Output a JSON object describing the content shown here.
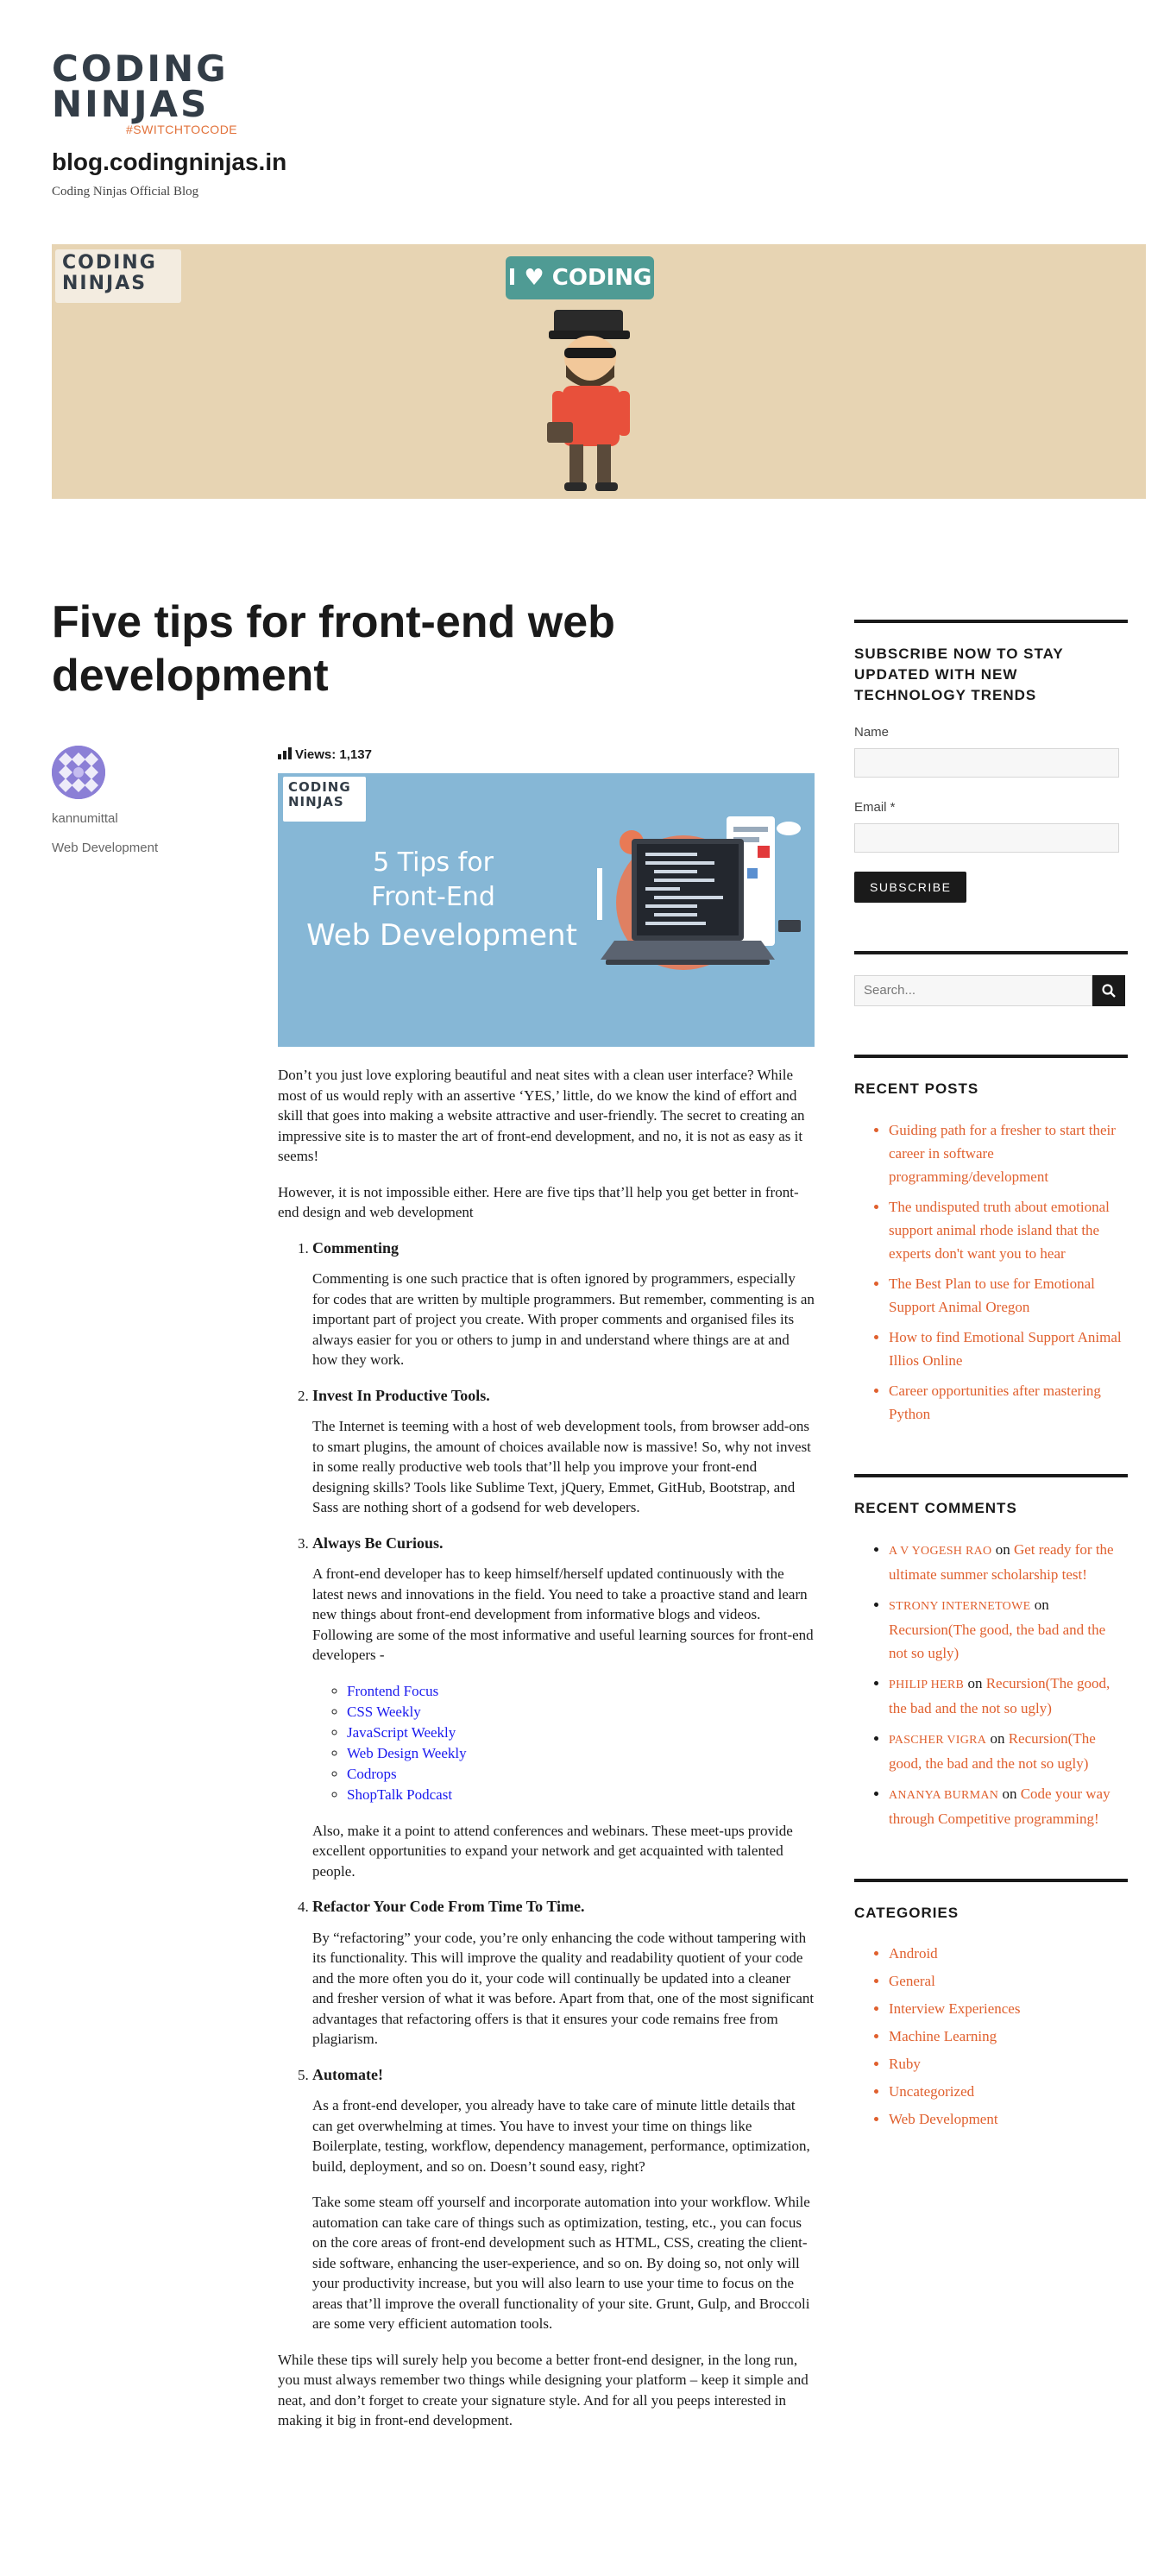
{
  "header": {
    "logo_row1": "CODING",
    "logo_row2": "NINJAS",
    "logo_tagline": "#SWITCHTOCODE",
    "site_title": "blog.codingninjas.in",
    "site_description": "Coding Ninjas Official Blog"
  },
  "banner": {
    "logo_row1": "CODING",
    "logo_row2": "NINJAS",
    "sign_text": "I ♥ CODING",
    "bg_color": "#e7d4b3"
  },
  "post": {
    "title": "Five tips for front-end web development",
    "author": "kannumittal",
    "category": "Web Development",
    "views_label": "Views: 1,137",
    "feature_image": {
      "logo_row1": "CODING",
      "logo_row2": "NINJAS",
      "line1": "5 Tips for",
      "line2": "Front-End",
      "line3": "Web Development",
      "bg_color": "#86b7d6"
    },
    "intro1": "Don’t you just love exploring beautiful and neat sites with a clean user interface? While most of us would reply with an assertive ‘YES,’ little, do we know the kind of effort and skill that goes into making a website attractive and user-friendly. The secret to creating an impressive site is to master the art of front-end development, and no, it is not as easy as it seems!",
    "intro2": "However, it is not impossible either. Here are five tips that’ll help you get better in front-end design and web development",
    "tips": [
      {
        "heading": "Commenting",
        "body": "Commenting is one such practice that is often ignored by programmers, especially for codes that are written by multiple programmers. But remember, commenting is an important part of project you create. With proper comments and organised files its always easier for you or others to jump in and understand where things are at and how they work."
      },
      {
        "heading": "Invest In Productive Tools.",
        "body": "The Internet is teeming with a host of web development tools, from browser add-ons to smart plugins, the amount of choices available now is massive! So, why not invest in some really productive web tools that’ll help you improve your front-end designing skills? Tools like Sublime Text, jQuery, Emmet, GitHub, Bootstrap, and Sass are nothing short of a godsend for web developers."
      },
      {
        "heading": "Always Be Curious.",
        "body": "A front-end developer has to keep himself/herself updated continuously with the latest news and innovations in the field. You need to take a proactive stand and learn new things about front-end development from informative blogs and videos. Following are some of the most informative and useful learning sources for front-end developers -",
        "links": [
          "Frontend Focus",
          "CSS Weekly",
          "JavaScript Weekly",
          "Web Design Weekly",
          "Codrops",
          "ShopTalk Podcast"
        ],
        "after": "Also, make it a point to attend conferences and webinars. These meet-ups provide excellent opportunities to expand your network and get acquainted with talented people."
      },
      {
        "heading": "Refactor Your Code From Time To Time.",
        "body": "By “refactoring” your code, you’re only enhancing the code without tampering with its functionality. This will improve the quality and readability quotient of your code and the more often you do it, your code will continually be updated into a cleaner and fresher version of what it was before. Apart from that, one of the most significant advantages that refactoring offers is that it ensures your code remains free from plagiarism."
      },
      {
        "heading": "Automate!",
        "body": "As a front-end developer, you already have to take care of minute little details that can get overwhelming at times. You have to invest your time on things like Boilerplate, testing, workflow, dependency management, performance, optimization, build, deployment, and so on. Doesn’t sound easy, right?",
        "after": "Take some steam off yourself and incorporate automation into your workflow. While automation can take care of things such as optimization, testing, etc., you can focus on the core areas of front-end development such as HTML, CSS, creating the client-side software, enhancing the user-experience, and so on. By doing so, not only will your productivity increase, but you will also learn to use your time to focus on the areas that’ll improve the overall functionality of your site. Grunt, Gulp, and Broccoli are some very efficient automation tools."
      }
    ],
    "outro": "While these tips will surely help you become a better front-end designer, in the long run, you must always remember two things while designing your platform – keep it simple and neat, and don’t forget to create your signature style. And for all you peeps interested in making it big in front-end development."
  },
  "sidebar": {
    "subscribe": {
      "title": "Subscribe now to stay updated with new technology trends",
      "name_label": "Name",
      "email_label": "Email *",
      "button_label": "Subscribe"
    },
    "search": {
      "placeholder": "Search..."
    },
    "recent_posts": {
      "title": "Recent Posts",
      "items": [
        "Guiding path for a fresher to start their career in software programming/development",
        "The undisputed truth about emotional support animal rhode island that the experts don't want you to hear",
        "The Best Plan to use for Emotional Support Animal Oregon",
        "How to find Emotional Support Animal Illios Online",
        "Career opportunities after mastering Python"
      ]
    },
    "recent_comments": {
      "title": "Recent Comments",
      "on_word": "on",
      "items": [
        {
          "author": "A V Yogesh Rao",
          "post": "Get ready for the ultimate summer scholarship test!"
        },
        {
          "author": "Strony internetowe",
          "post": "Recursion(The good, the bad and the not so ugly)"
        },
        {
          "author": "Philip Herb",
          "post": "Recursion(The good, the bad and the not so ugly)"
        },
        {
          "author": "Pascher Vigra",
          "post": "Recursion(The good, the bad and the not so ugly)"
        },
        {
          "author": "Ananya Burman",
          "post": "Code your way through Competitive programming!"
        }
      ]
    },
    "categories": {
      "title": "Categories",
      "items": [
        "Android",
        "General",
        "Interview Experiences",
        "Machine Learning",
        "Ruby",
        "Uncategorized",
        "Web Development"
      ]
    }
  },
  "colors": {
    "accent": "#e0602e",
    "logo_orange": "#e2723b",
    "text": "#1a1a1a",
    "link_blue": "#1a1aee"
  }
}
